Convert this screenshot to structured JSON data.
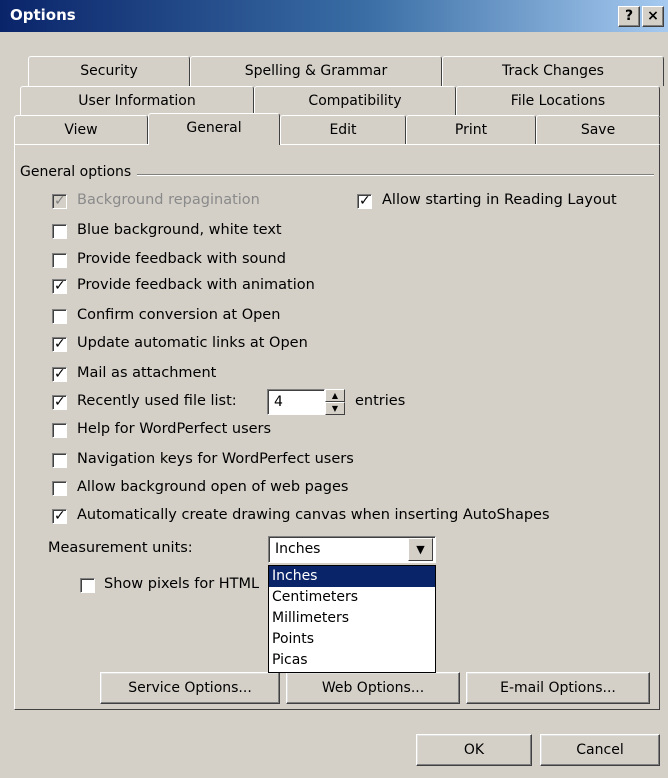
{
  "window": {
    "title": "Options",
    "help_label": "?",
    "close_label": "×"
  },
  "tabs": {
    "row1": [
      "Security",
      "Spelling & Grammar",
      "Track Changes"
    ],
    "row2": [
      "User Information",
      "Compatibility",
      "File Locations"
    ],
    "row3": [
      "View",
      "General",
      "Edit",
      "Print",
      "Save"
    ],
    "active": "General"
  },
  "general": {
    "group_title": "General options",
    "background_repagination": "Background repagination",
    "reading_layout": "Allow starting in Reading Layout",
    "blue_background": "Blue background, white text",
    "feedback_sound": "Provide feedback with sound",
    "feedback_animation": "Provide feedback with animation",
    "confirm_conversion": "Confirm conversion at Open",
    "update_links": "Update automatic links at Open",
    "mail_attachment": "Mail as attachment",
    "recent_files": "Recently used file list:",
    "recent_count": "4",
    "entries": "entries",
    "help_wordperfect": "Help for WordPerfect users",
    "nav_wordperfect": "Navigation keys for WordPerfect users",
    "background_web": "Allow background open of web pages",
    "drawing_canvas": "Automatically create drawing canvas when inserting AutoShapes",
    "measurement_label": "Measurement units:",
    "measurement_value": "Inches",
    "measurement_options": [
      "Inches",
      "Centimeters",
      "Millimeters",
      "Points",
      "Picas"
    ],
    "show_pixels": "Show pixels for HTML"
  },
  "checks": {
    "background_repagination": true,
    "reading_layout": true,
    "blue_background": false,
    "feedback_sound": false,
    "feedback_animation": true,
    "confirm_conversion": false,
    "update_links": true,
    "mail_attachment": true,
    "recent_files": true,
    "help_wordperfect": false,
    "nav_wordperfect": false,
    "background_web": false,
    "drawing_canvas": true,
    "show_pixels": false
  },
  "buttons": {
    "service_options": "Service Options...",
    "web_options": "Web Options...",
    "email_options": "E-mail Options...",
    "ok": "OK",
    "cancel": "Cancel"
  },
  "colors": {
    "face": "#d4d0c8",
    "title_start": "#0a246a",
    "title_end": "#a6caf0",
    "selection": "#0a246a"
  }
}
